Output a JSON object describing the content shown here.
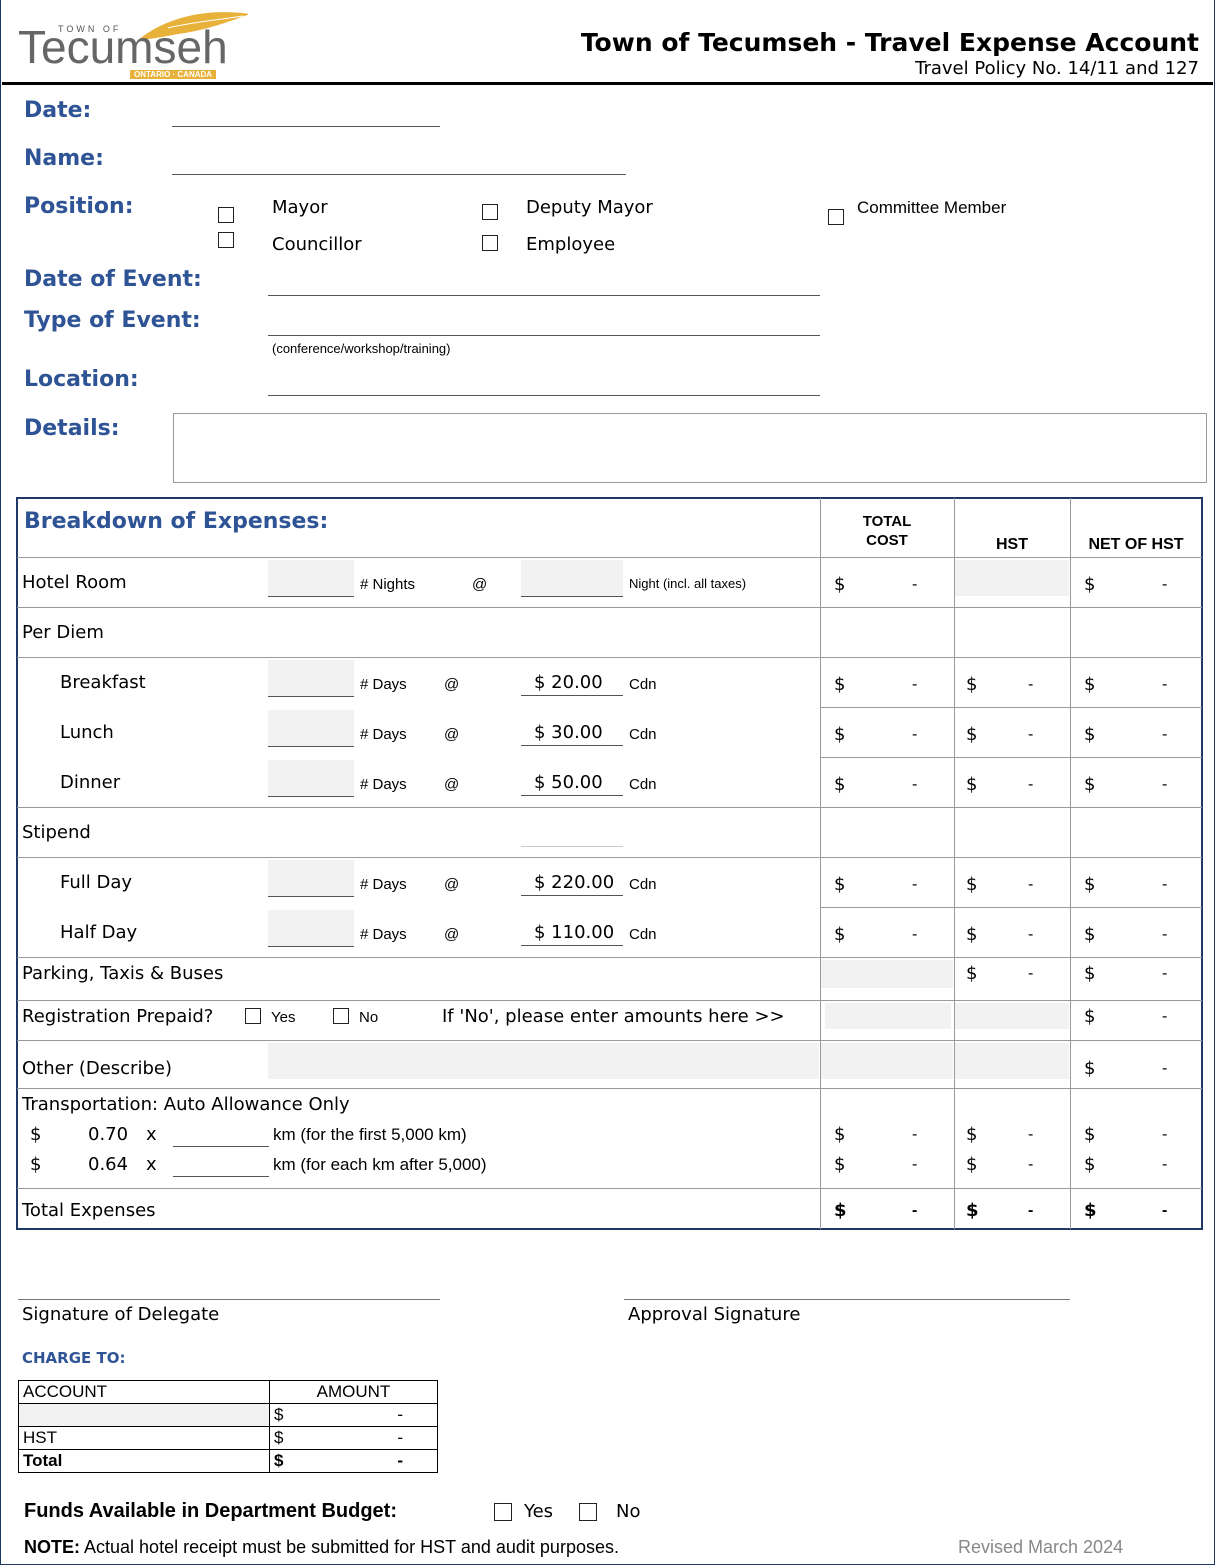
{
  "header": {
    "logo_small": "TOWN OF",
    "logo_main": "Tecumseh",
    "logo_sub": "ONTARIO · CANADA",
    "title": "Town of Tecumseh - Travel Expense Account",
    "subtitle": "Travel Policy No. 14/11 and 127"
  },
  "form": {
    "date_label": "Date:",
    "name_label": "Name:",
    "position_label": "Position:",
    "positions": [
      "Mayor",
      "Deputy Mayor",
      "Committee Member",
      "Councillor",
      "Employee"
    ],
    "date_event_label": "Date of Event:",
    "type_event_label": "Type of Event:",
    "type_event_hint": "(conference/workshop/training)",
    "location_label": "Location:",
    "details_label": "Details:"
  },
  "breakdown": {
    "title": "Breakdown of Expenses:",
    "col_total_1": "TOTAL",
    "col_total_2": "COST",
    "col_hst": "HST",
    "col_net": "NET OF HST",
    "currency": "$",
    "dash": "-",
    "at": "@",
    "cdn": "Cdn",
    "nights": "# Nights",
    "days": "# Days",
    "night_note": "Night (incl. all taxes)",
    "hotel": "Hotel Room",
    "per_diem": "Per Diem",
    "breakfast": "Breakfast",
    "breakfast_rate": "$  20.00",
    "lunch": "Lunch",
    "lunch_rate": "$  30.00",
    "dinner": "Dinner",
    "dinner_rate": "$  50.00",
    "stipend": "Stipend",
    "full_day": "Full Day",
    "full_day_rate": "$ 220.00",
    "half_day": "Half Day",
    "half_day_rate": "$ 110.00",
    "parking": "Parking, Taxis & Buses",
    "registration": "Registration Prepaid?",
    "yes": "Yes",
    "no": "No",
    "if_no": "If 'No', please enter amounts here >>",
    "other": "Other (Describe)",
    "transport": "Transportation:  Auto Allowance Only",
    "rate1": "0.70",
    "rate2": "0.64",
    "x": "x",
    "km1": "km (for the first 5,000 km)",
    "km2": "km (for each km after 5,000)",
    "total": "Total Expenses"
  },
  "signatures": {
    "delegate": "Signature of Delegate",
    "approval": "Approval Signature"
  },
  "charge": {
    "title": "CHARGE TO:",
    "col_account": "ACCOUNT",
    "col_amount": "AMOUNT",
    "hst": "HST",
    "total": "Total"
  },
  "footer": {
    "funds": "Funds Available in Department Budget:",
    "yes": "Yes",
    "no": "No",
    "note_bold": "NOTE:",
    "note": "Actual hotel receipt must be submitted for HST and audit purposes.",
    "revised": "Revised March 2024"
  }
}
